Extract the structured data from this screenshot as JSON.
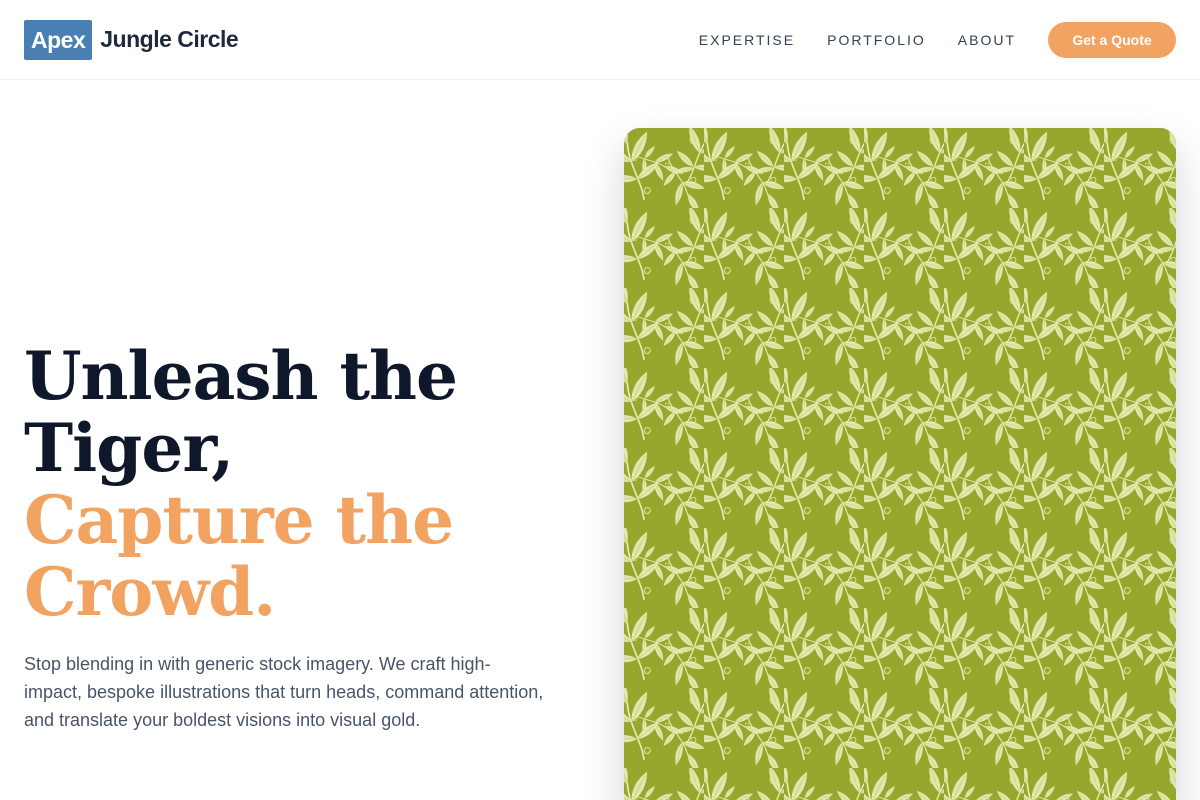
{
  "header": {
    "logo_badge": "Apex",
    "logo_name": "Jungle Circle",
    "nav": [
      {
        "label": "EXPERTISE"
      },
      {
        "label": "PORTFOLIO"
      },
      {
        "label": "ABOUT"
      }
    ],
    "cta_label": "Get a Quote"
  },
  "hero": {
    "headline_line1": "Unleash the",
    "headline_line2": "Tiger,",
    "headline_accent_line1": "Capture the",
    "headline_accent_line2": "Crowd.",
    "description": "Stop blending in with generic stock imagery. We craft high-impact, bespoke illustrations that turn heads, command attention, and translate your boldest visions into visual gold."
  },
  "colors": {
    "brand_badge": "#4a7fb3",
    "accent": "#f2a261",
    "headline": "#0f172a",
    "body_text": "#475569",
    "pattern_base": "#97a62c",
    "pattern_leaf": "#f1f3c8"
  },
  "icons": {
    "hero_image": "green-leaf-pattern-illustration"
  }
}
